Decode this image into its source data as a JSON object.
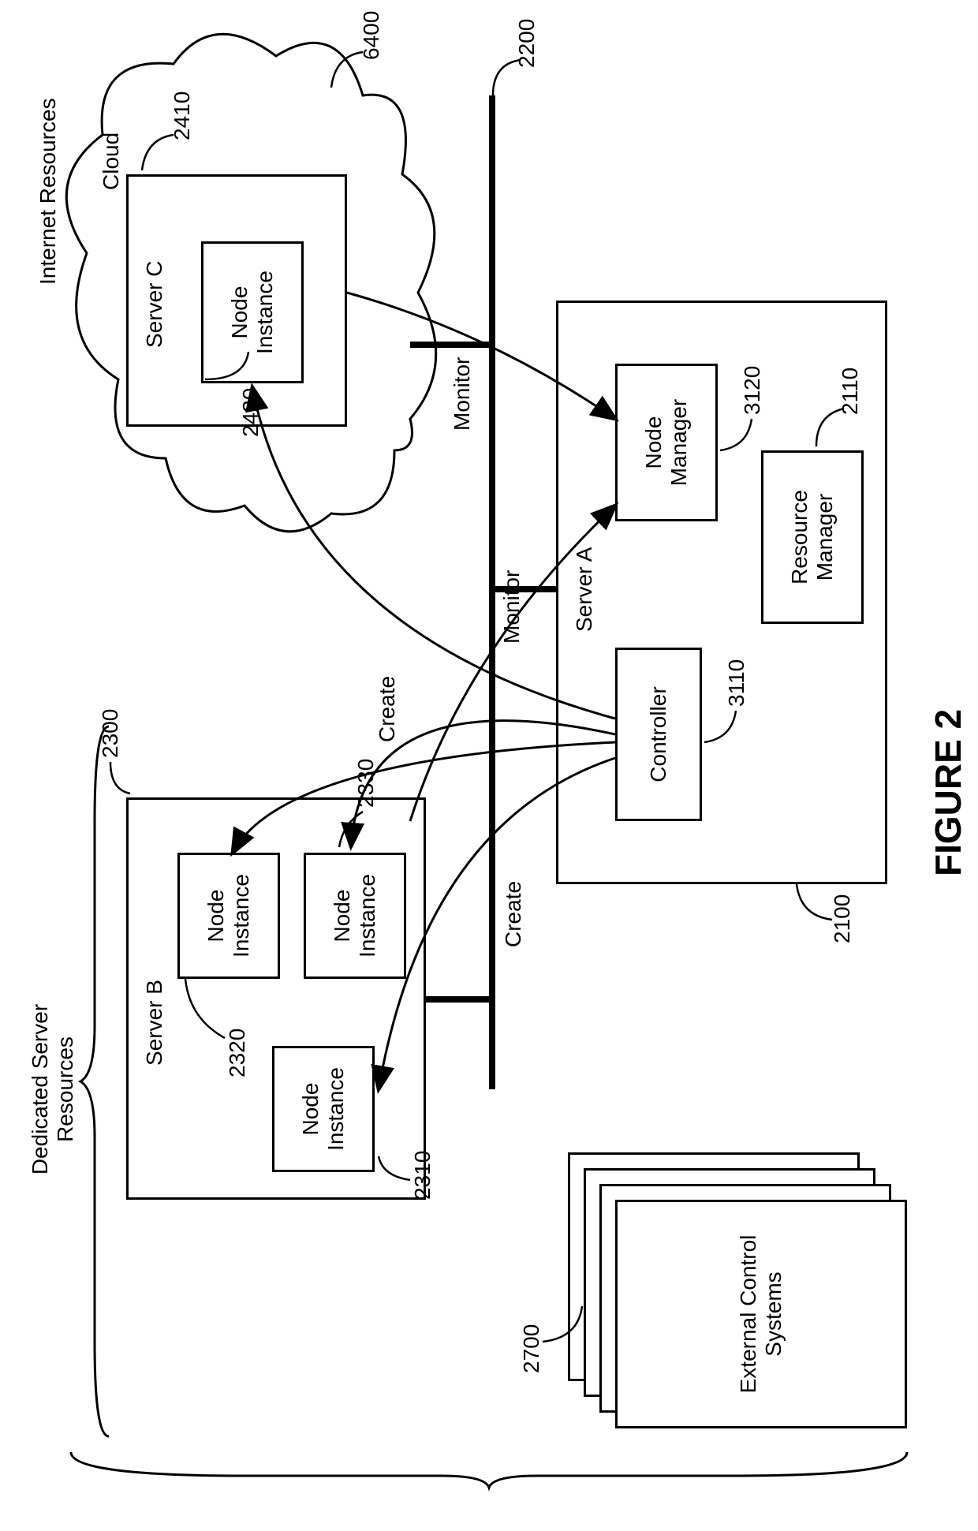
{
  "figure": {
    "title": "FIGURE 2"
  },
  "sections": {
    "dedicated": "Dedicated Server\nResources",
    "internet": "Internet Resources"
  },
  "cloud": {
    "label": "Cloud"
  },
  "serverA": {
    "title": "Server A",
    "controller": "Controller",
    "nodeManager": "Node\nManager",
    "resourceManager": "Resource\nManager"
  },
  "serverB": {
    "title": "Server B",
    "node1": "Node\nInstance",
    "node2": "Node\nInstance",
    "node3": "Node\nInstance"
  },
  "serverC": {
    "title": "Server C",
    "node": "Node\nInstance"
  },
  "external": {
    "label": "External Control\nSystems"
  },
  "actions": {
    "create1": "Create",
    "create2": "Create",
    "monitor1": "Monitor",
    "monitor2": "Monitor"
  },
  "refs": {
    "r2100": "2100",
    "r2110": "2110",
    "r2200": "2200",
    "r2300": "2300",
    "r2310": "2310",
    "r2320": "2320",
    "r2330": "2330",
    "r2410": "2410",
    "r2420": "2420",
    "r2700": "2700",
    "r3110": "3110",
    "r3120": "3120",
    "r6400": "6400"
  }
}
